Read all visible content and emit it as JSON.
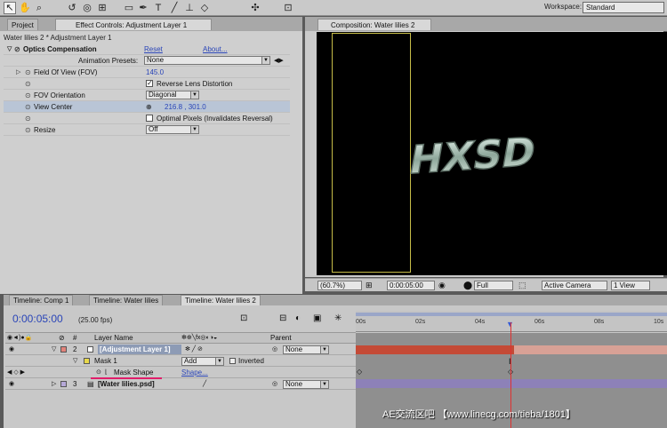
{
  "toolbar": {
    "tools": [
      "select-tool",
      "hand-tool",
      "zoom-tool",
      "rotate-tool",
      "orbit-camera-tool",
      "pan-behind-tool",
      "rectangle-mask-tool",
      "pen-tool",
      "text-tool",
      "brush-tool",
      "clone-stamp-tool",
      "eraser-tool",
      "axis-local",
      "axis-world"
    ],
    "workspace_label": "Workspace:",
    "workspace_value": "Standard"
  },
  "left_panel": {
    "tabs": [
      "Project",
      "Effect Controls: Adjustment Layer 1"
    ],
    "header": "Water lilies 2 * Adjustment Layer 1",
    "effect_name": "Optics Compensation",
    "reset_label": "Reset",
    "about_label": "About...",
    "presets_label": "Animation Presets:",
    "presets_value": "None",
    "fov_label": "Field Of View (FOV)",
    "fov_value": "145.0",
    "reverse_label": "Reverse Lens Distortion",
    "reverse_checked": "✓",
    "orientation_label": "FOV Orientation",
    "orientation_value": "Diagonal",
    "view_center_label": "View Center",
    "view_center_value": "216.8 , 301.0",
    "optimal_label": "Optimal Pixels (Invalidates Reversal)",
    "resize_label": "Resize",
    "resize_value": "Off"
  },
  "comp_panel": {
    "tab": "Composition: Water lilies 2",
    "artwork": "HXSD",
    "zoom": "(60.7%)",
    "timecode": "0:00:05:00",
    "resolution": "Full",
    "camera": "Active Camera",
    "views": "1 View"
  },
  "timeline": {
    "tabs": [
      "Timeline: Comp 1",
      "Timeline: Water lilies",
      "Timeline: Water lilies 2"
    ],
    "time": "0:00:05:00",
    "fps": "(25.00 fps)",
    "col_number": "#",
    "col_layer": "Layer Name",
    "col_parent": "Parent",
    "layers": [
      {
        "num": "2",
        "name": "[Adjustment Layer 1]",
        "parent": "None",
        "color": "#c44a36"
      },
      {
        "num": "3",
        "name": "[Water lilies.psd]",
        "parent": "None",
        "color": "#8d81b8"
      }
    ],
    "mask_name": "Mask 1",
    "mask_mode": "Add",
    "mask_inverted": "Inverted",
    "mask_shape_label": "Mask Shape",
    "mask_shape_value": "Shape...",
    "ruler_ticks": [
      "00s",
      "02s",
      "04s",
      "06s",
      "08s",
      "10s"
    ]
  },
  "watermark": "AE交流区吧 【www.linecg.com/tieba/1801】",
  "colors": {
    "accent": "#2a45b8",
    "comp_bg": "#000000",
    "frame": "#c7bd48",
    "playhead": "#e03030"
  }
}
